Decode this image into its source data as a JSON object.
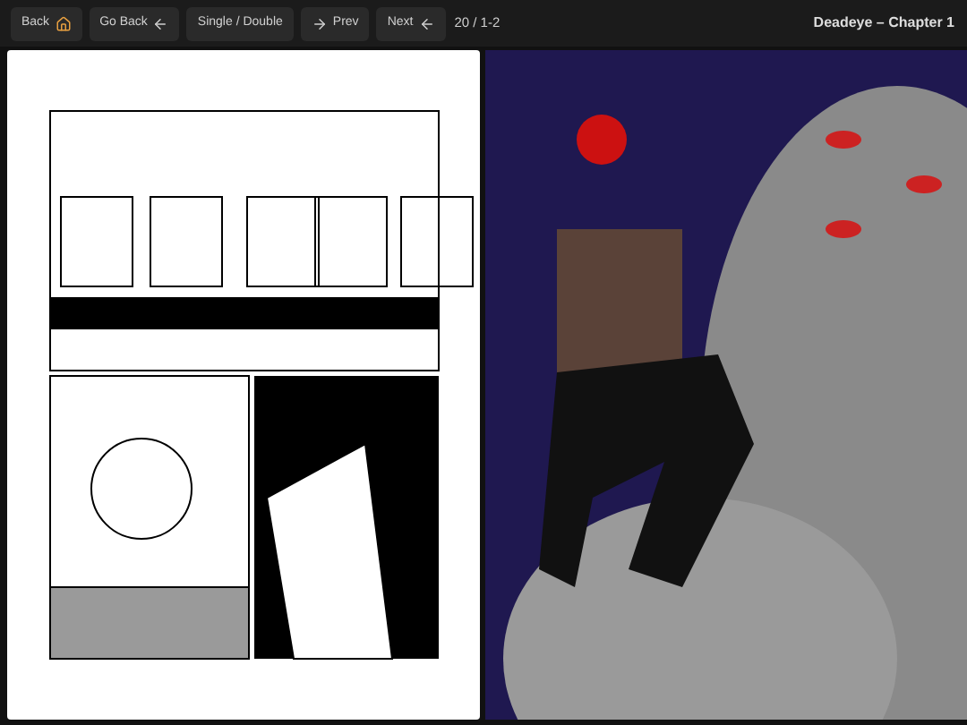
{
  "toolbar": {
    "buttons": [
      {
        "label": "Back"
      },
      {
        "label": "Go Back"
      },
      {
        "label": "Single / Double"
      },
      {
        "label": "Prev"
      },
      {
        "label": "Next"
      }
    ],
    "page_counter": "20 / 1-2",
    "title": "Deadeye – Chapter 1"
  }
}
